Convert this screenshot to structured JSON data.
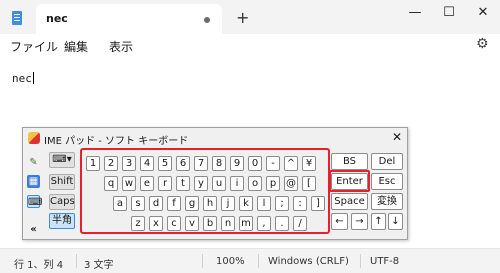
{
  "window": {
    "tab_title": "nec",
    "new_tab": "+",
    "minimize": "—",
    "maximize": "☐",
    "close": "✕"
  },
  "menu": {
    "file": "ファイル",
    "edit": "編集",
    "view": "表示"
  },
  "editor": {
    "text": "nec"
  },
  "ime": {
    "title": "IME パッド - ソフト キーボード",
    "close": "✕",
    "modes": [
      "Shift",
      "Caps",
      "半角"
    ],
    "row1": [
      "1",
      "2",
      "3",
      "4",
      "5",
      "6",
      "7",
      "8",
      "9",
      "0",
      "-",
      "^",
      "¥"
    ],
    "row2": [
      "q",
      "w",
      "e",
      "r",
      "t",
      "y",
      "u",
      "i",
      "o",
      "p",
      "@",
      "["
    ],
    "row3": [
      "a",
      "s",
      "d",
      "f",
      "g",
      "h",
      "j",
      "k",
      "l",
      ";",
      ":",
      "]"
    ],
    "row4": [
      "z",
      "x",
      "c",
      "v",
      "b",
      "n",
      "m",
      ",",
      ".",
      "/"
    ],
    "right_keys": {
      "bs": "BS",
      "del": "Del",
      "enter": "Enter",
      "esc": "Esc",
      "space": "Space",
      "convert": "変換",
      "left": "←",
      "right": "→",
      "up": "↑",
      "down": "↓"
    },
    "collapse": "«"
  },
  "status": {
    "position": "行 1、列 4",
    "chars": "3 文字",
    "zoom": "100%",
    "line_ending": "Windows (CRLF)",
    "encoding": "UTF-8"
  }
}
